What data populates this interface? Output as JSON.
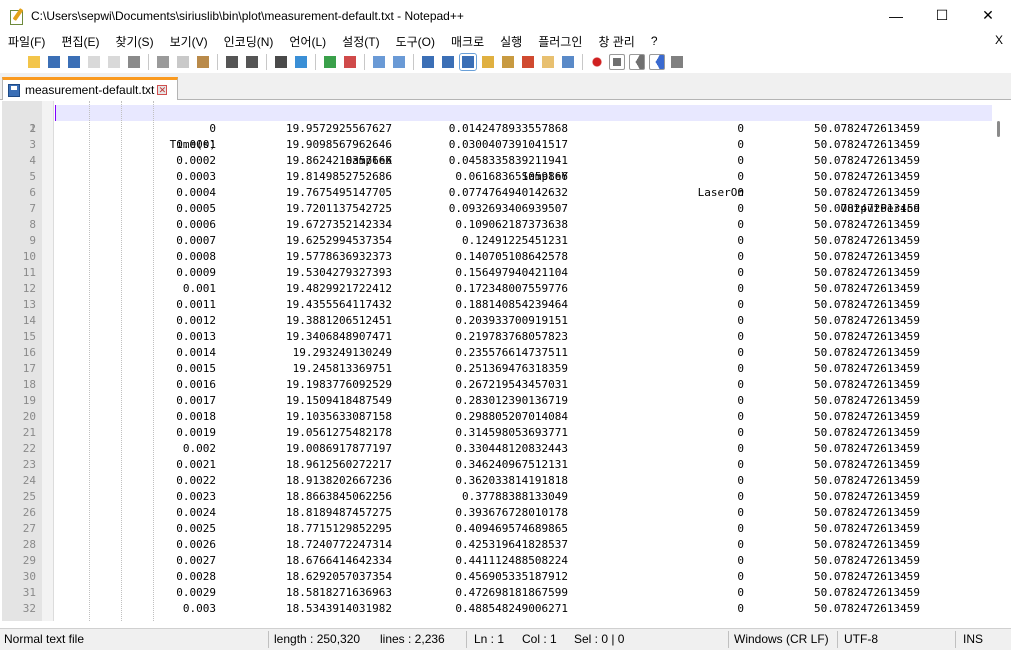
{
  "window": {
    "title": "C:\\Users\\sepwi\\Documents\\siriuslib\\bin\\plot\\measurement-default.txt - Notepad++",
    "buttons": [
      "—",
      "☐",
      "✕"
    ]
  },
  "menu": {
    "items": [
      "파일(F)",
      "편집(E)",
      "찾기(S)",
      "보기(V)",
      "인코딩(N)",
      "언어(L)",
      "설정(T)",
      "도구(O)",
      "매크로",
      "실행",
      "플러그인",
      "창 관리",
      "?"
    ],
    "close": "X"
  },
  "toolbar": {
    "icons": [
      "new-file-icon",
      "open-file-icon",
      "save-icon",
      "save-all-icon",
      "close-icon",
      "close-all-icon",
      "print-icon",
      "cut-icon",
      "copy-icon",
      "paste-icon",
      "undo-icon",
      "redo-icon",
      "find-icon",
      "replace-icon",
      "zoom-in-icon",
      "zoom-out-icon",
      "sync-vertical-icon",
      "sync-horizontal-icon",
      "word-wrap-icon",
      "show-all-chars-icon",
      "indent-guide-icon",
      "udl-icon",
      "doc-map-icon",
      "function-list-icon",
      "folder-workspace-icon",
      "monitoring-icon",
      "record-macro-icon",
      "stop-macro-icon",
      "play-macro-icon",
      "run-macro-multiple-icon",
      "save-macro-icon"
    ]
  },
  "tab": {
    "label": "measurement-default.txt",
    "close": "✕"
  },
  "editor": {
    "header": {
      "ln": "1",
      "cols": [
        "Time(s)",
        "SampleX",
        "SampleY",
        "LaserOn",
        "OutputPeriod"
      ]
    },
    "rows": [
      {
        "ln": "2",
        "cols": [
          "0",
          "19.9572925567627",
          "0.0142478933557868",
          "0",
          "50.0782472613459"
        ]
      },
      {
        "ln": "3",
        "cols": [
          "0.0001",
          "19.9098567962646",
          "0.0300407391041517",
          "0",
          "50.0782472613459"
        ]
      },
      {
        "ln": "4",
        "cols": [
          "0.0002",
          "19.8624210357666",
          "0.0458335839211941",
          "0",
          "50.0782472613459"
        ]
      },
      {
        "ln": "5",
        "cols": [
          "0.0003",
          "19.8149852752686",
          "0.061683651059866",
          "0",
          "50.0782472613459"
        ]
      },
      {
        "ln": "6",
        "cols": [
          "0.0004",
          "19.7675495147705",
          "0.0774764940142632",
          "0",
          "50.0782472613459"
        ]
      },
      {
        "ln": "7",
        "cols": [
          "0.0005",
          "19.7201137542725",
          "0.0932693406939507",
          "0",
          "50.0782472613459"
        ]
      },
      {
        "ln": "8",
        "cols": [
          "0.0006",
          "19.6727352142334",
          "0.109062187373638",
          "0",
          "50.0782472613459"
        ]
      },
      {
        "ln": "9",
        "cols": [
          "0.0007",
          "19.6252994537354",
          "0.12491225451231",
          "0",
          "50.0782472613459"
        ]
      },
      {
        "ln": "10",
        "cols": [
          "0.0008",
          "19.5778636932373",
          "0.140705108642578",
          "0",
          "50.0782472613459"
        ]
      },
      {
        "ln": "11",
        "cols": [
          "0.0009",
          "19.5304279327393",
          "0.156497940421104",
          "0",
          "50.0782472613459"
        ]
      },
      {
        "ln": "12",
        "cols": [
          "0.001",
          "19.4829921722412",
          "0.172348007559776",
          "0",
          "50.0782472613459"
        ]
      },
      {
        "ln": "13",
        "cols": [
          "0.0011",
          "19.4355564117432",
          "0.188140854239464",
          "0",
          "50.0782472613459"
        ]
      },
      {
        "ln": "14",
        "cols": [
          "0.0012",
          "19.3881206512451",
          "0.203933700919151",
          "0",
          "50.0782472613459"
        ]
      },
      {
        "ln": "15",
        "cols": [
          "0.0013",
          "19.3406848907471",
          "0.219783768057823",
          "0",
          "50.0782472613459"
        ]
      },
      {
        "ln": "16",
        "cols": [
          "0.0014",
          "19.293249130249",
          "0.235576614737511",
          "0",
          "50.0782472613459"
        ]
      },
      {
        "ln": "17",
        "cols": [
          "0.0015",
          "19.245813369751",
          "0.251369476318359",
          "0",
          "50.0782472613459"
        ]
      },
      {
        "ln": "18",
        "cols": [
          "0.0016",
          "19.1983776092529",
          "0.267219543457031",
          "0",
          "50.0782472613459"
        ]
      },
      {
        "ln": "19",
        "cols": [
          "0.0017",
          "19.1509418487549",
          "0.283012390136719",
          "0",
          "50.0782472613459"
        ]
      },
      {
        "ln": "20",
        "cols": [
          "0.0018",
          "19.1035633087158",
          "0.298805207014084",
          "0",
          "50.0782472613459"
        ]
      },
      {
        "ln": "21",
        "cols": [
          "0.0019",
          "19.0561275482178",
          "0.314598053693771",
          "0",
          "50.0782472613459"
        ]
      },
      {
        "ln": "22",
        "cols": [
          "0.002",
          "19.0086917877197",
          "0.330448120832443",
          "0",
          "50.0782472613459"
        ]
      },
      {
        "ln": "23",
        "cols": [
          "0.0021",
          "18.9612560272217",
          "0.346240967512131",
          "0",
          "50.0782472613459"
        ]
      },
      {
        "ln": "24",
        "cols": [
          "0.0022",
          "18.9138202667236",
          "0.362033814191818",
          "0",
          "50.0782472613459"
        ]
      },
      {
        "ln": "25",
        "cols": [
          "0.0023",
          "18.8663845062256",
          "0.37788388133049",
          "0",
          "50.0782472613459"
        ]
      },
      {
        "ln": "26",
        "cols": [
          "0.0024",
          "18.8189487457275",
          "0.393676728010178",
          "0",
          "50.0782472613459"
        ]
      },
      {
        "ln": "27",
        "cols": [
          "0.0025",
          "18.7715129852295",
          "0.409469574689865",
          "0",
          "50.0782472613459"
        ]
      },
      {
        "ln": "28",
        "cols": [
          "0.0026",
          "18.7240772247314",
          "0.425319641828537",
          "0",
          "50.0782472613459"
        ]
      },
      {
        "ln": "29",
        "cols": [
          "0.0027",
          "18.6766414642334",
          "0.441112488508224",
          "0",
          "50.0782472613459"
        ]
      },
      {
        "ln": "30",
        "cols": [
          "0.0028",
          "18.6292057037354",
          "0.456905335187912",
          "0",
          "50.0782472613459"
        ]
      },
      {
        "ln": "31",
        "cols": [
          "0.0029",
          "18.5818271636963",
          "0.472698181867599",
          "0",
          "50.0782472613459"
        ]
      },
      {
        "ln": "32",
        "cols": [
          "0.003",
          "18.5343914031982",
          "0.488548249006271",
          "0",
          "50.0782472613459"
        ]
      }
    ]
  },
  "status": {
    "type": "Normal text file",
    "length": "length : 250,320",
    "lines": "lines : 2,236",
    "ln": "Ln : 1",
    "col": "Col : 1",
    "sel": "Sel : 0 | 0",
    "eol": "Windows (CR LF)",
    "encoding": "UTF-8",
    "mode": "INS"
  },
  "colors": {
    "accent_tab": "#fa9a1f",
    "caret": "#8000ff",
    "current_line": "#e8e8ff"
  }
}
